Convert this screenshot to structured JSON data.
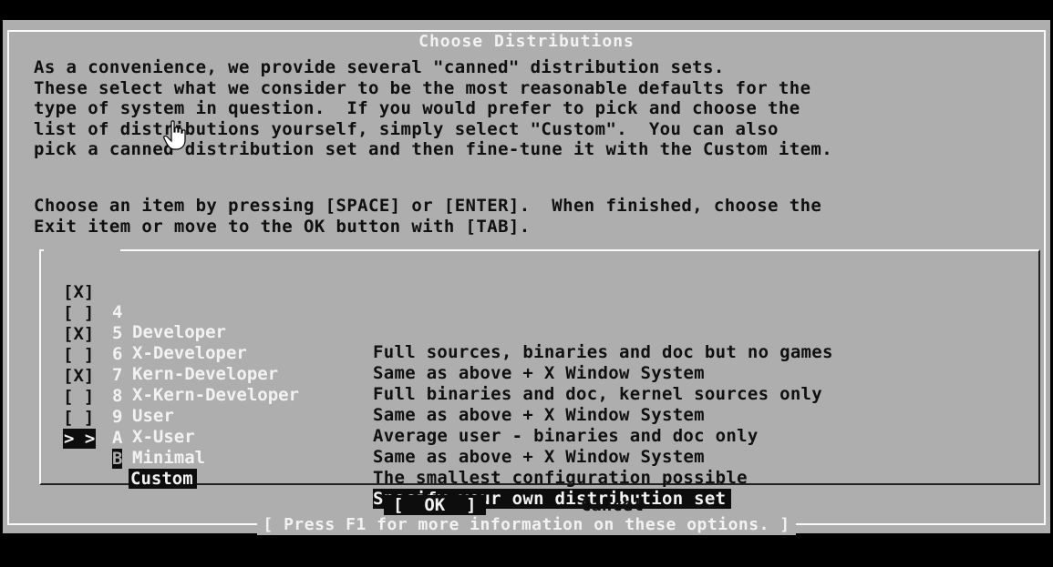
{
  "dialog": {
    "title": "Choose Distributions",
    "intro_lines": [
      "As a convenience, we provide several \"canned\" distribution sets.",
      "These select what we consider to be the most reasonable defaults for the",
      "type of system in question.  If you would prefer to pick and choose the",
      "list of distributions yourself, simply select \"Custom\".  You can also",
      "pick a canned distribution set and then fine-tune it with the Custom item."
    ],
    "instruction_lines": [
      "Choose an item by pressing [SPACE] or [ENTER].  When finished, choose the",
      "Exit item or move to the OK button with [TAB]."
    ],
    "items": [
      {
        "mark": "[X]",
        "key": "4",
        "name": "Developer",
        "description": "Full sources, binaries and doc but no games"
      },
      {
        "mark": "[ ]",
        "key": "5",
        "name": "X-Developer",
        "description": "Same as above + X Window System"
      },
      {
        "mark": "[X]",
        "key": "6",
        "name": "Kern-Developer",
        "description": "Full binaries and doc, kernel sources only"
      },
      {
        "mark": "[ ]",
        "key": "7",
        "name": "X-Kern-Developer",
        "description": "Same as above + X Window System"
      },
      {
        "mark": "[X]",
        "key": "8",
        "name": "User",
        "description": "Average user - binaries and doc only"
      },
      {
        "mark": "[ ]",
        "key": "9",
        "name": "X-User",
        "description": "Same as above + X Window System"
      },
      {
        "mark": "[ ]",
        "key": "A",
        "name": "Minimal",
        "description": "The smallest configuration possible"
      },
      {
        "mark": "> >",
        "key": "B",
        "name": "Custom",
        "description": "Specify your own distribution set"
      }
    ],
    "ok_button": "[  OK  ]",
    "cancel_button": "Cancel",
    "footer": "[ Press F1 for more information on these options. ]"
  },
  "colors": {
    "dialog_bg": "#aeaeae",
    "text": "#101010",
    "highlight_text": "#f2f2f2",
    "selection_bg": "#0d0d0d",
    "screen_bg": "#000000"
  }
}
